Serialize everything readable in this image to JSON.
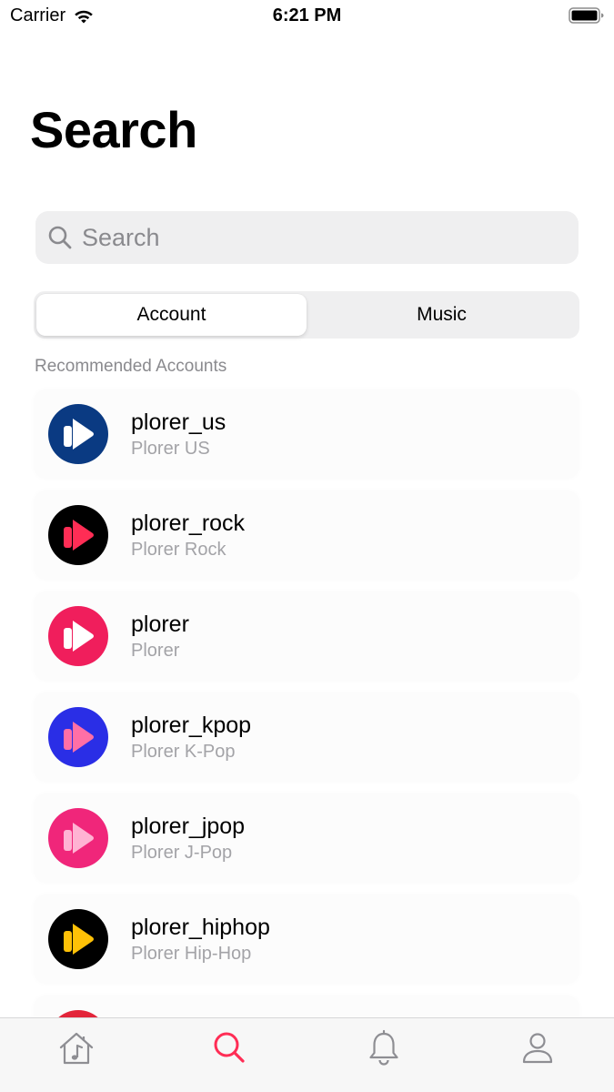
{
  "status_bar": {
    "carrier": "Carrier",
    "time": "6:21 PM"
  },
  "page_title": "Search",
  "search": {
    "placeholder": "Search",
    "value": ""
  },
  "segmented_control": {
    "segments": [
      "Account",
      "Music"
    ],
    "selected": "Account"
  },
  "section_header": "Recommended Accounts",
  "accounts": [
    {
      "username": "plorer_us",
      "display_name": "Plorer US",
      "avatar_bg": "#0a3a82",
      "bar_color": "#ffffff",
      "play_color": "#ffffff"
    },
    {
      "username": "plorer_rock",
      "display_name": "Plorer Rock",
      "avatar_bg": "#000000",
      "bar_color": "#ff2d55",
      "play_color": "#ff2d55"
    },
    {
      "username": "plorer",
      "display_name": "Plorer",
      "avatar_bg": "#f01e5c",
      "bar_color": "#ffffff",
      "play_color": "#ffffff"
    },
    {
      "username": "plorer_kpop",
      "display_name": "Plorer K-Pop",
      "avatar_bg": "#2a2ee6",
      "bar_color": "#ff6fa6",
      "play_color": "#ff6fa6"
    },
    {
      "username": "plorer_jpop",
      "display_name": "Plorer J-Pop",
      "avatar_bg": "#f0267a",
      "bar_color": "#ffb3d3",
      "play_color": "#ffb3d3"
    },
    {
      "username": "plorer_hiphop",
      "display_name": "Plorer Hip-Hop",
      "avatar_bg": "#000000",
      "bar_color": "#ffc107",
      "play_color": "#ffc107"
    },
    {
      "username": "",
      "display_name": "",
      "avatar_bg": "#e3253a",
      "bar_color": "#ffffff",
      "play_color": "#ffffff"
    }
  ],
  "tab_bar": {
    "items": [
      {
        "name": "home-music-icon",
        "active": false
      },
      {
        "name": "search-icon",
        "active": true
      },
      {
        "name": "bell-icon",
        "active": false
      },
      {
        "name": "profile-icon",
        "active": false
      }
    ],
    "active_color": "#ff2d55",
    "inactive_color": "#8e8e93"
  }
}
